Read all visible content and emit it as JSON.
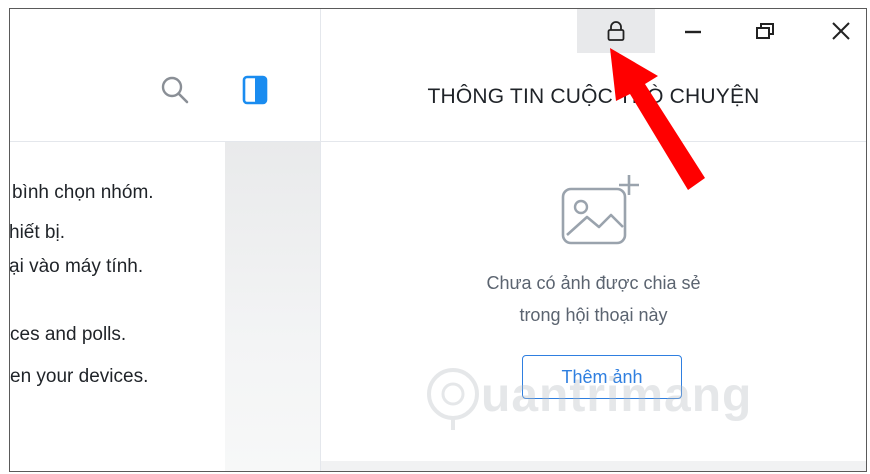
{
  "chat": {
    "lines": [
      "bình chọn nhóm.",
      "hiết bị.",
      "ại vào máy tính.",
      "ces and polls.",
      "en your devices."
    ]
  },
  "info_panel": {
    "title": "THÔNG TIN CUỘC TRÒ CHUYỆN",
    "empty_line1": "Chưa có ảnh được chia sẻ",
    "empty_line2": "trong hội thoại này",
    "add_photo_label": "Thêm ảnh"
  },
  "watermark": {
    "text": "uantrimang"
  },
  "colors": {
    "accent": "#2f7fe0",
    "arrow": "#ff0000",
    "lock_button_bg": "#e8e9eb"
  },
  "icons": {
    "search": "search-icon",
    "panel_toggle": "panel-toggle-icon",
    "lock": "lock-icon",
    "minimize": "minimize-icon",
    "maximize": "restore-icon",
    "close": "close-icon",
    "photo_add": "image-add-icon"
  }
}
